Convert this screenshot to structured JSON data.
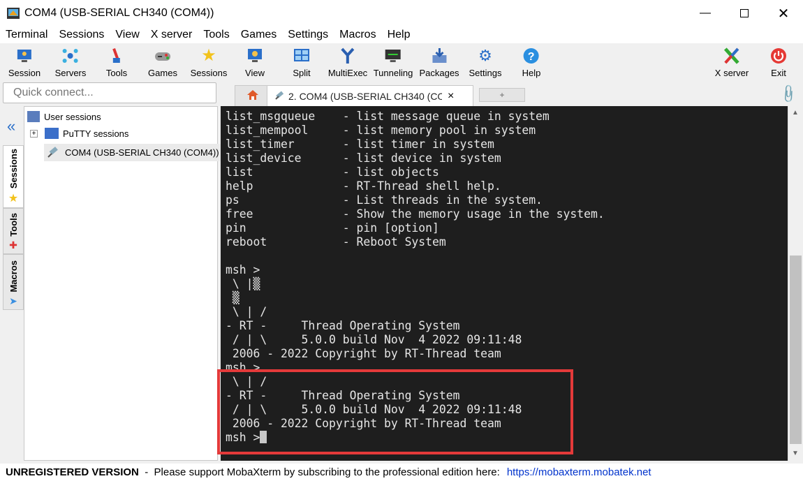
{
  "window": {
    "title": "COM4  (USB-SERIAL CH340 (COM4))",
    "minimize_icon": "minimize-icon",
    "maximize_icon": "maximize-icon",
    "close_icon": "close-icon"
  },
  "menu": [
    "Terminal",
    "Sessions",
    "View",
    "X server",
    "Tools",
    "Games",
    "Settings",
    "Macros",
    "Help"
  ],
  "toolbar": {
    "session": "Session",
    "servers": "Servers",
    "tools": "Tools",
    "games": "Games",
    "sessions": "Sessions",
    "view": "View",
    "split": "Split",
    "multiexec": "MultiExec",
    "tunneling": "Tunneling",
    "packages": "Packages",
    "settings": "Settings",
    "help": "Help",
    "xserver": "X server",
    "exit": "Exit"
  },
  "quick_connect": {
    "placeholder": "Quick connect..."
  },
  "tabs": {
    "session_tab_label": "2. COM4  (USB-SERIAL CH340 (COM",
    "close_glyph": "×",
    "new_tab_glyph": "+"
  },
  "sidebar_tabs": {
    "sessions": "Sessions",
    "tools": "Tools",
    "macros": "Macros",
    "collapse_glyph": "«"
  },
  "tree": {
    "user_sessions": "User sessions",
    "putty_sessions": "PuTTY sessions",
    "com_session": "COM4  (USB-SERIAL CH340 (COM4))",
    "expand_glyph": "+"
  },
  "terminal": {
    "lines": [
      "list_msgqueue    - list message queue in system",
      "list_mempool     - list memory pool in system",
      "list_timer       - list timer in system",
      "list_device      - list device in system",
      "list             - list objects",
      "help             - RT-Thread shell help.",
      "ps               - List threads in the system.",
      "free             - Show the memory usage in the system.",
      "pin              - pin [option]",
      "reboot           - Reboot System",
      "",
      "msh >",
      " \\ |▒",
      " ▒",
      " \\ | /",
      "- RT -     Thread Operating System",
      " / | \\     5.0.0 build Nov  4 2022 09:11:48",
      " 2006 - 2022 Copyright by RT-Thread team",
      "msh >",
      " \\ | /",
      "- RT -     Thread Operating System",
      " / | \\     5.0.0 build Nov  4 2022 09:11:48",
      " 2006 - 2022 Copyright by RT-Thread team"
    ],
    "prompt": "msh >"
  },
  "status": {
    "unregistered": "UNREGISTERED VERSION",
    "message": "  -  Please support MobaXterm by subscribing to the professional edition here:",
    "link": "https://mobaxterm.mobatek.net"
  },
  "colors": {
    "highlight": "#e43a3a",
    "terminal_bg": "#1e1e1e"
  }
}
